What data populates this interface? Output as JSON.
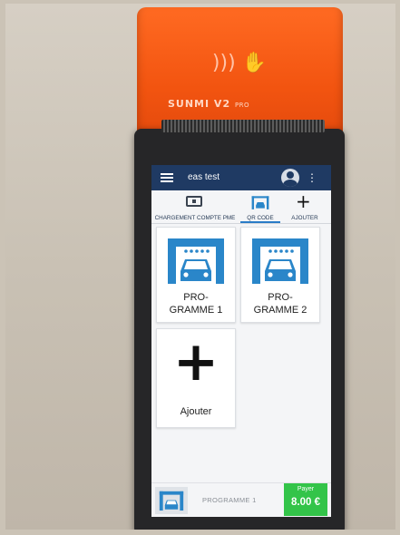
{
  "device": {
    "brand": "SUNMI V2",
    "brand_suffix": "PRO"
  },
  "app_bar": {
    "title": "eas test",
    "menu_icon": "hamburger-menu-icon",
    "account_icon": "account-circle-icon",
    "overflow_icon": "more-vertical-icon"
  },
  "tabs": [
    {
      "label": "CHARGEMENT COMPTE PME",
      "icon": "wallet-icon",
      "active": false
    },
    {
      "label": "QR CODE",
      "icon": "car-wash-icon",
      "active": true
    },
    {
      "label": "AJOUTER",
      "icon": "plus-icon",
      "active": false
    }
  ],
  "programs": [
    {
      "line1": "PRO-",
      "line2": "GRAMME 1",
      "icon": "car-wash-icon"
    },
    {
      "line1": "PRO-",
      "line2": "GRAMME 2",
      "icon": "car-wash-icon"
    }
  ],
  "add_tile": {
    "label": "Ajouter",
    "icon": "plus-icon"
  },
  "bottom_bar": {
    "selected_program": "PROGRAMME 1",
    "pay_label": "Payer",
    "pay_amount": "8.00 €"
  },
  "colors": {
    "device_orange": "#f25410",
    "app_bar": "#1f3a63",
    "icon_blue": "#2a86c9",
    "pay_green": "#33c449"
  }
}
